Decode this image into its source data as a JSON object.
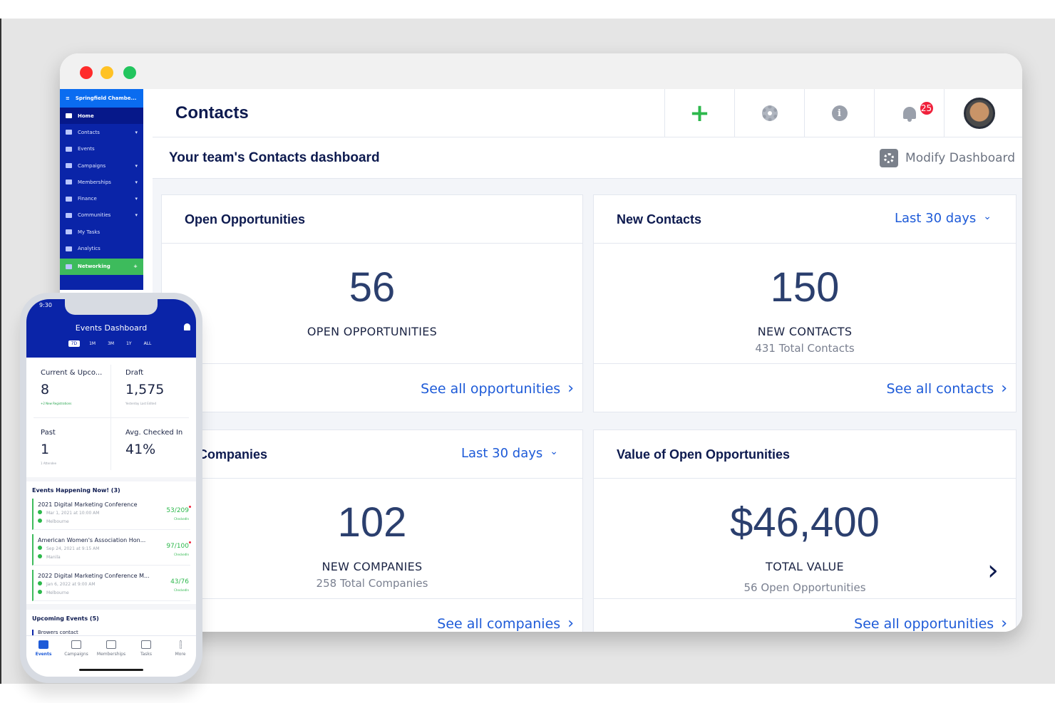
{
  "sidebar": {
    "org": "Springfield Chambe...",
    "items": [
      {
        "label": "Home"
      },
      {
        "label": "Contacts"
      },
      {
        "label": "Events"
      },
      {
        "label": "Campaigns"
      },
      {
        "label": "Memberships"
      },
      {
        "label": "Finance"
      },
      {
        "label": "Communities"
      },
      {
        "label": "My Tasks"
      },
      {
        "label": "Analytics"
      },
      {
        "label": "Networking"
      }
    ]
  },
  "header": {
    "title": "Contacts",
    "add_icon": "+",
    "notification_count": "25",
    "info_icon": "i"
  },
  "subheader": {
    "title": "Your team's Contacts dashboard",
    "modify_label": "Modify Dashboard"
  },
  "cards": {
    "open_opps": {
      "title": "Open Opportunities",
      "value": "56",
      "label": "OPEN OPPORTUNITIES",
      "link": "See all opportunities"
    },
    "new_contacts": {
      "title": "New Contacts",
      "filter": "Last 30 days",
      "value": "150",
      "label": "NEW CONTACTS",
      "sub": "431 Total Contacts",
      "link": "See all contacts"
    },
    "new_companies": {
      "title": "w Companies",
      "filter": "Last 30 days",
      "value": "102",
      "label": "NEW COMPANIES",
      "sub": "258 Total Companies",
      "link": "See all companies"
    },
    "value_opps": {
      "title": "Value of Open Opportunities",
      "value": "$46,400",
      "label": "TOTAL VALUE",
      "sub": "56 Open Opportunities",
      "link": "See all opportunities",
      "chevron": "›"
    }
  },
  "phone": {
    "time": "9:30",
    "title": "Events Dashboard",
    "ranges": [
      "7D",
      "1M",
      "3M",
      "1Y",
      "ALL"
    ],
    "stats": [
      {
        "label": "Current & Upco...",
        "value": "8",
        "note": "+2 New Registrations"
      },
      {
        "label": "Draft",
        "value": "1,575",
        "note": "Yesterday Last Edited"
      },
      {
        "label": "Past",
        "value": "1",
        "note": "1 Attendee"
      },
      {
        "label": "Avg. Checked In",
        "value": "41%",
        "note": ""
      }
    ],
    "happening_title": "Events Happening Now! (3)",
    "events": [
      {
        "name": "2021 Digital Marketing Conference",
        "date": "Mar 1, 2021 at 10:00 AM",
        "location": "Melbourne",
        "count": "53/209",
        "checked": "CheckedIn"
      },
      {
        "name": "American Women's Association Hon...",
        "date": "Sep 24, 2021 at 9:15 AM",
        "location": "Manila",
        "count": "97/100",
        "checked": "CheckedIn"
      },
      {
        "name": "2022 Digital Marketing Conference M...",
        "date": "Jan 6, 2022 at 9:00 AM",
        "location": "Melbourne",
        "count": "43/76",
        "checked": "CheckedIn"
      }
    ],
    "upcoming_title": "Upcoming Events (5)",
    "upcoming_first": "Browers contact",
    "tabs": [
      "Events",
      "Campaigns",
      "Memberships",
      "Tasks",
      "More"
    ]
  }
}
